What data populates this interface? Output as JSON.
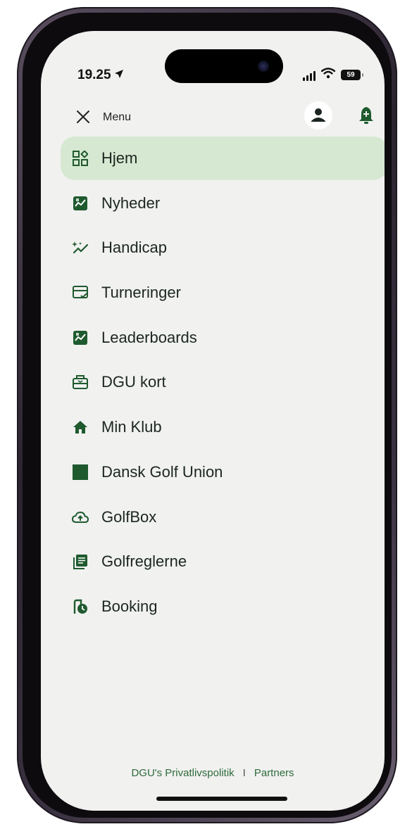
{
  "status_bar": {
    "time": "19.25",
    "battery": "59"
  },
  "header": {
    "title": "Menu"
  },
  "nav": {
    "items": [
      {
        "label": "Hjem",
        "icon": "dashboard-icon",
        "active": true
      },
      {
        "label": "Nyheder",
        "icon": "news-icon",
        "active": false
      },
      {
        "label": "Handicap",
        "icon": "sparkle-chart-icon",
        "active": false
      },
      {
        "label": "Turneringer",
        "icon": "tournament-icon",
        "active": false
      },
      {
        "label": "Leaderboards",
        "icon": "leaderboard-icon",
        "active": false
      },
      {
        "label": "DGU kort",
        "icon": "card-icon",
        "active": false
      },
      {
        "label": "Min Klub",
        "icon": "home-icon",
        "active": false
      },
      {
        "label": "Dansk Golf Union",
        "icon": "square-icon",
        "active": false
      },
      {
        "label": "GolfBox",
        "icon": "cloud-upload-icon",
        "active": false
      },
      {
        "label": "Golfreglerne",
        "icon": "rulebook-icon",
        "active": false
      },
      {
        "label": "Booking",
        "icon": "booking-clock-icon",
        "active": false
      }
    ]
  },
  "footer": {
    "privacy_link": "DGU's Privatlivspolitik",
    "separator": "I",
    "partners_link": "Partners"
  },
  "colors": {
    "accent_green": "#1f5a2e",
    "active_bg": "#d6e8d1",
    "screen_bg": "#f1f1f0",
    "footer_link": "#2e6b3a"
  }
}
